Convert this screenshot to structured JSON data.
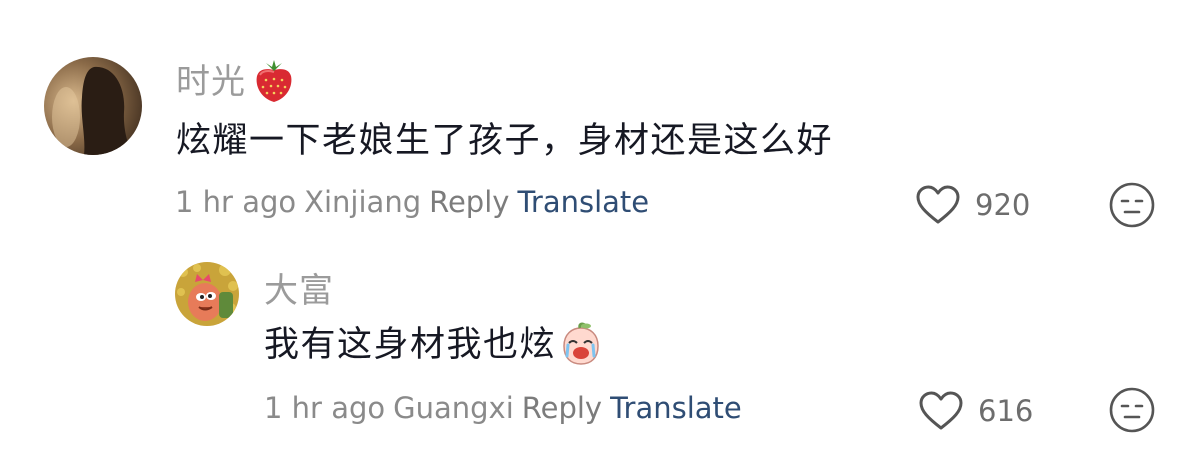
{
  "comments": [
    {
      "username": "时光",
      "username_emoji": "strawberry-emoji",
      "text": "炫耀一下老娘生了孩子，身材还是这么好",
      "time": "1 hr ago",
      "location": "Xinjiang",
      "reply_label": "Reply",
      "translate_label": "Translate",
      "likes": "920",
      "like_icon": "heart-outline-icon",
      "reaction_icon": "expressionless-face-icon"
    },
    {
      "username": "大富",
      "text": "我有这身材我也炫",
      "text_emoji": "crying-peach-sticker",
      "time": "1 hr ago",
      "location": "Guangxi",
      "reply_label": "Reply",
      "translate_label": "Translate",
      "likes": "616",
      "like_icon": "heart-outline-icon",
      "reaction_icon": "expressionless-face-icon"
    }
  ],
  "colors": {
    "username": "#9b9b9b",
    "body_text": "#161823",
    "meta": "#8a8a8a",
    "translate": "#2f4d74",
    "icon": "#555555"
  }
}
